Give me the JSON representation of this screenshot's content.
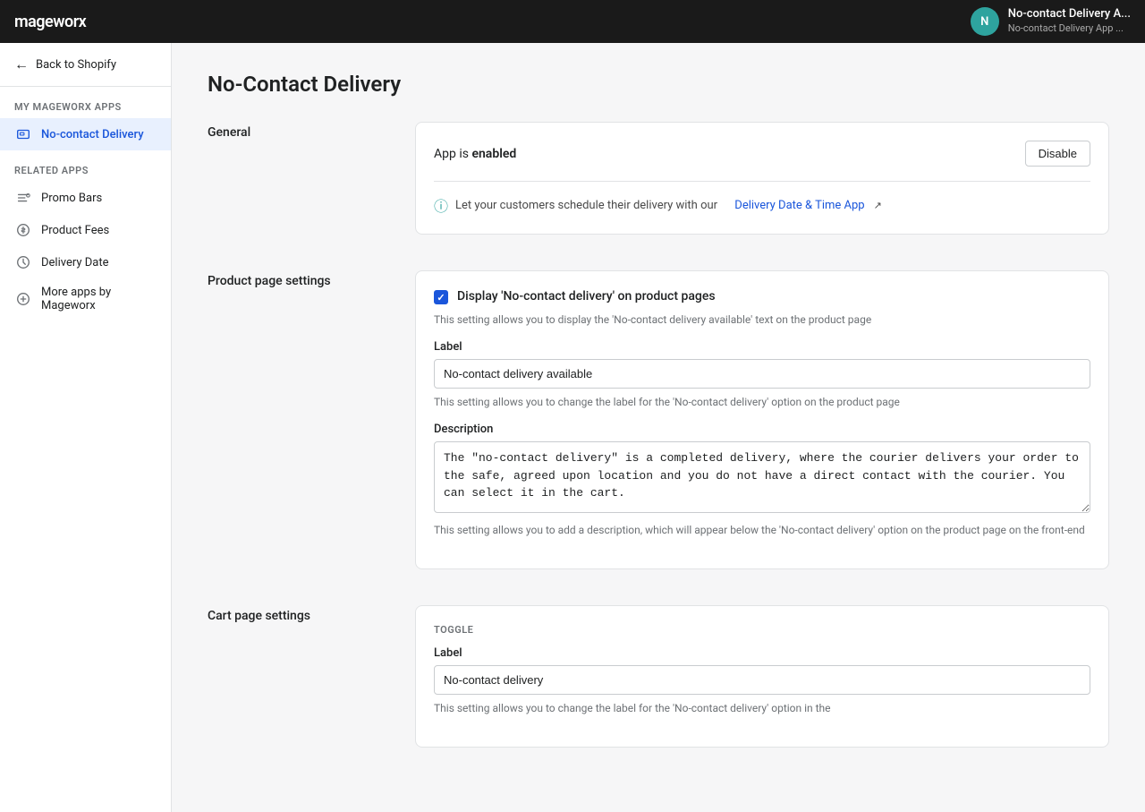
{
  "topnav": {
    "logo": "mageworx",
    "avatar_initial": "N",
    "app_name": "No-contact Delivery A...",
    "app_sub": "No-contact Delivery App ..."
  },
  "sidebar": {
    "back_label": "Back to Shopify",
    "my_apps_section": "MY MAGEWORX APPS",
    "active_item": "No-contact Delivery",
    "related_section": "RELATED APPS",
    "related_items": [
      {
        "id": "promo-bars",
        "label": "Promo Bars"
      },
      {
        "id": "product-fees",
        "label": "Product Fees"
      },
      {
        "id": "delivery-date",
        "label": "Delivery Date"
      },
      {
        "id": "more-apps",
        "label": "More apps by Mageworx"
      }
    ]
  },
  "page": {
    "title": "No-Contact Delivery"
  },
  "general": {
    "section_label": "General",
    "app_status": "App is",
    "app_status_bold": "enabled",
    "disable_btn": "Disable",
    "info_text": "Let your customers schedule their delivery with our",
    "info_link": "Delivery Date & Time App"
  },
  "product_page_settings": {
    "section_label": "Product page settings",
    "checkbox_label": "Display 'No-contact delivery' on product pages",
    "checkbox_helper": "This setting allows you to display the 'No-contact delivery available' text on the product page",
    "label_field": "Label",
    "label_value": "No-contact delivery available",
    "label_helper": "This setting allows you to change the label for the 'No-contact delivery' option on the product page",
    "description_field": "Description",
    "description_value": "The \"no-contact delivery\" is a completed delivery, where the courier delivers your order to the safe, agreed upon location and you do not have a direct contact with the courier. You can select it in the cart.",
    "description_helper": "This setting allows you to add a description, which will appear below the 'No-contact delivery' option on the product page on the front-end"
  },
  "cart_page_settings": {
    "section_label": "Cart page settings",
    "toggle_section": "TOGGLE",
    "label_field": "Label",
    "label_value": "No-contact delivery",
    "label_helper": "This setting allows you to change the label for the 'No-contact delivery' option in the"
  }
}
